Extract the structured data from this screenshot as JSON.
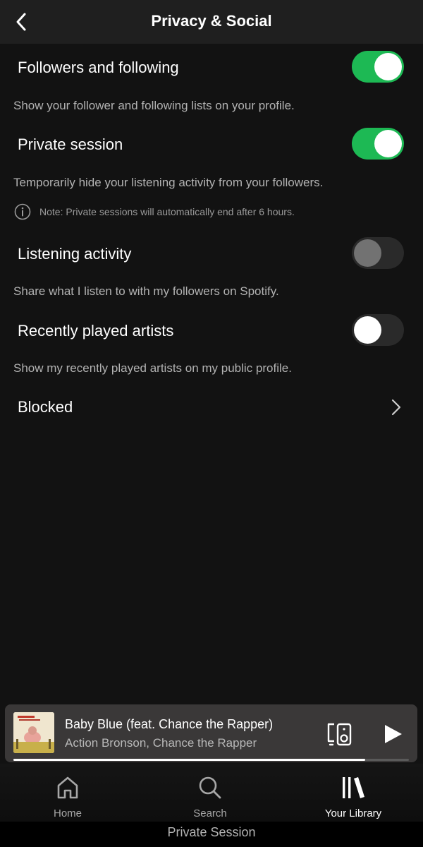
{
  "header": {
    "title": "Privacy & Social",
    "back_icon": "chevron-left-icon"
  },
  "settings": [
    {
      "label": "Followers and following",
      "description": "Show your follower and following lists on your profile.",
      "state": "on"
    },
    {
      "label": "Private session",
      "description": "Temporarily hide your listening activity from your followers.",
      "state": "on"
    },
    {
      "label": "Listening activity",
      "description": "Share what I listen to with my followers on Spotify.",
      "state": "disabled"
    },
    {
      "label": "Recently played artists",
      "description": "Show my recently played artists on my public profile.",
      "state": "off"
    }
  ],
  "note": {
    "icon": "info-icon",
    "text": "Note: Private sessions will automatically end after 6 hours."
  },
  "blocked": {
    "label": "Blocked",
    "icon": "chevron-right-icon"
  },
  "player": {
    "title": "Baby Blue (feat. Chance the Rapper)",
    "artist": "Action Bronson, Chance the Rapper",
    "progress": 0.89,
    "device_icon": "connect-device-icon",
    "play_icon": "play-icon"
  },
  "nav": {
    "items": [
      {
        "label": "Home",
        "icon": "home-icon",
        "active": false
      },
      {
        "label": "Search",
        "icon": "search-icon",
        "active": false
      },
      {
        "label": "Your Library",
        "icon": "library-icon",
        "active": true
      }
    ]
  },
  "private_session_banner": "Private Session",
  "colors": {
    "background": "#121212",
    "accent_green": "#1db954",
    "secondary_text": "#b3b3b3",
    "player_bg": "#3a3838"
  }
}
